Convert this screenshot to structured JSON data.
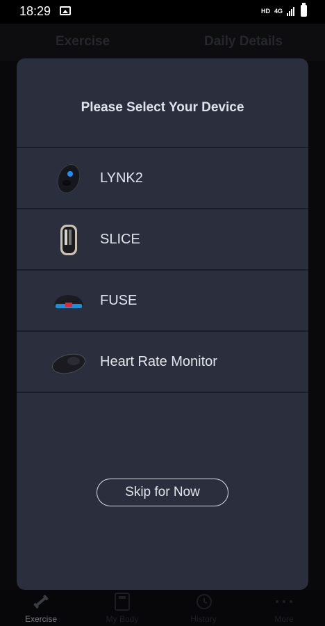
{
  "status_bar": {
    "time": "18:29",
    "hd": "HD",
    "network": "4G",
    "icons": [
      "gallery-icon",
      "signal-icon",
      "battery-icon"
    ]
  },
  "background": {
    "tabs": [
      "Exercise",
      "Daily Details"
    ],
    "bottom_nav": [
      {
        "label": "Exercise",
        "icon": "dumbbell-icon",
        "active": true
      },
      {
        "label": "My Body",
        "icon": "scale-icon",
        "active": false
      },
      {
        "label": "History",
        "icon": "history-icon",
        "active": false
      },
      {
        "label": "More",
        "icon": "more-icon",
        "active": false
      }
    ]
  },
  "dialog": {
    "title": "Please Select Your Device",
    "devices": [
      {
        "name": "LYNK2",
        "icon": "lynk2-device-icon"
      },
      {
        "name": "SLICE",
        "icon": "slice-device-icon"
      },
      {
        "name": "FUSE",
        "icon": "fuse-device-icon"
      },
      {
        "name": "Heart Rate Monitor",
        "icon": "heart-rate-monitor-icon"
      }
    ],
    "skip_label": "Skip for Now"
  },
  "colors": {
    "dialog_bg": "#2b2e3d",
    "divider": "#1b1d27",
    "accent_blue": "#1e90ff",
    "accent_red": "#e0263a"
  }
}
